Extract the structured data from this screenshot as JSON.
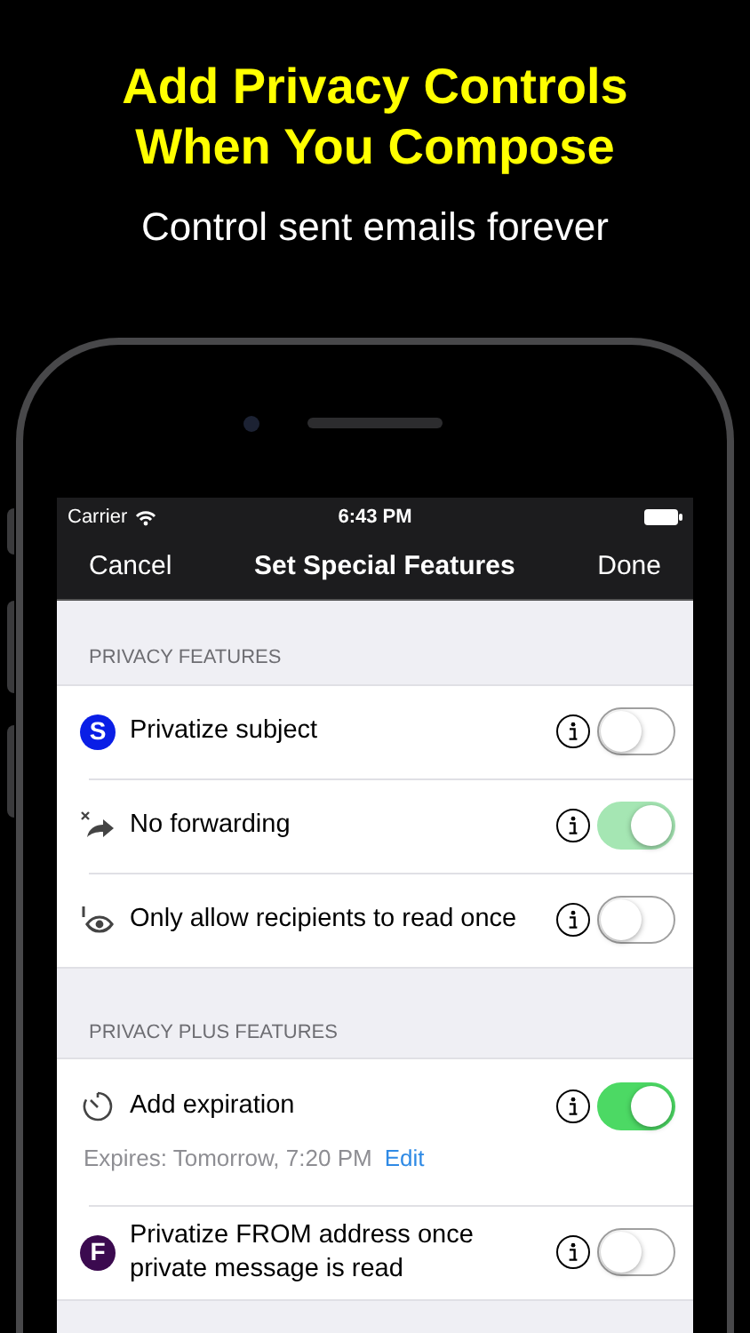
{
  "headline": "Add Privacy Controls\nWhen You Compose",
  "subtitle": "Control sent emails forever",
  "status_bar": {
    "carrier": "Carrier",
    "time": "6:43 PM"
  },
  "nav_bar": {
    "left": "Cancel",
    "title": "Set Special Features",
    "right": "Done"
  },
  "sections": [
    {
      "header": "PRIVACY FEATURES",
      "rows": [
        {
          "kind": "letter",
          "letter": "S",
          "color": "#0a1ee6",
          "label": "Privatize subject",
          "on": false,
          "disabled": false
        },
        {
          "kind": "no-forward",
          "label": "No forwarding",
          "on": true,
          "disabled": true
        },
        {
          "kind": "read-once",
          "label": "Only allow recipients to read once",
          "on": false,
          "disabled": false
        }
      ]
    },
    {
      "header": "PRIVACY PLUS FEATURES",
      "rows": [
        {
          "kind": "timer",
          "label": "Add expiration",
          "on": true,
          "disabled": false,
          "detail": "Expires: Tomorrow, 7:20 PM",
          "detail_link": "Edit"
        },
        {
          "kind": "letter",
          "letter": "F",
          "color": "#3b0a4f",
          "label": "Privatize FROM address once\nprivate message is read",
          "on": false,
          "disabled": false
        }
      ]
    }
  ]
}
